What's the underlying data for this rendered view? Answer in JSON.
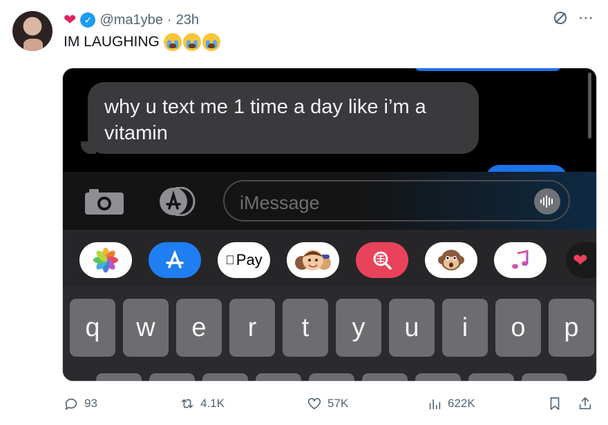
{
  "tweet": {
    "handle": "@ma1ybe",
    "separator": "·",
    "time": "23h",
    "text": "IM LAUGHING",
    "emoji_icons": [
      "loudly-crying-face",
      "loudly-crying-face",
      "loudly-crying-face"
    ]
  },
  "screenshot": {
    "message_text": "why u text me 1 time a day like i’m a vitamin",
    "compose_placeholder": "iMessage",
    "apple_pay_label": "Pay",
    "keys_row1": [
      "q",
      "w",
      "e",
      "r",
      "t",
      "y",
      "u",
      "i",
      "o",
      "p"
    ]
  },
  "actions": {
    "replies": "93",
    "reposts": "4.1K",
    "likes": "57K",
    "views": "622K"
  },
  "colors": {
    "accent": "#1d9bf0",
    "heart": "#e0245e",
    "imessage_blue": "#1a73e8"
  }
}
